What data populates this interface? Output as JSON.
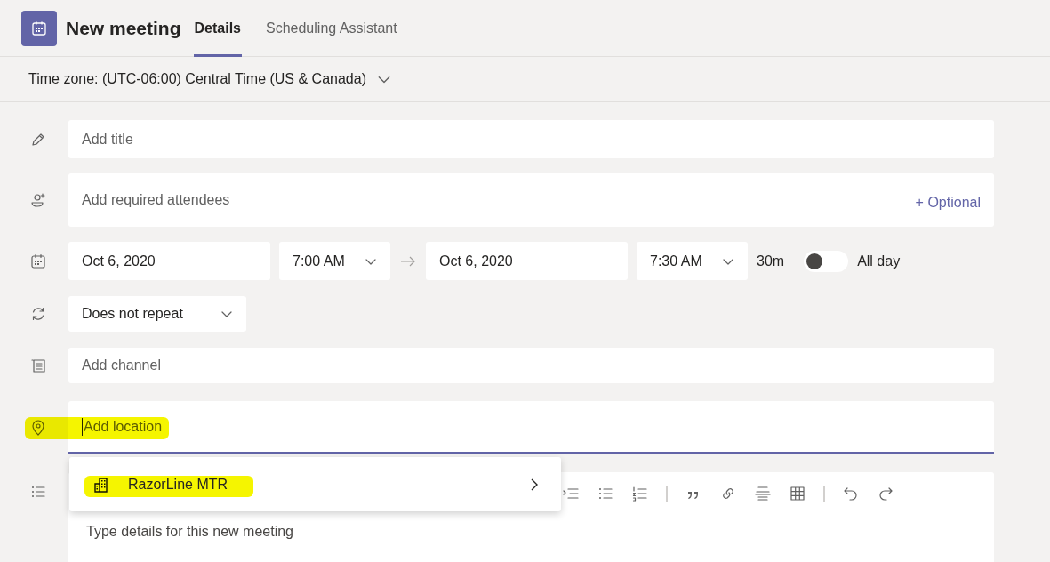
{
  "header": {
    "title": "New meeting",
    "tabs": [
      {
        "label": "Details",
        "selected": true
      },
      {
        "label": "Scheduling Assistant",
        "selected": false
      }
    ]
  },
  "timezone": "Time zone: (UTC-06:00) Central Time (US & Canada)",
  "title_field": {
    "placeholder": "Add title"
  },
  "attendees": {
    "placeholder": "Add required attendees",
    "optional_link": "+ Optional"
  },
  "date_row": {
    "start_date": "Oct 6, 2020",
    "start_time": "7:00 AM",
    "end_date": "Oct 6, 2020",
    "end_time": "7:30 AM",
    "duration": "30m",
    "all_day": {
      "label": "All day",
      "on": false
    }
  },
  "repeat": "Does not repeat",
  "channel": {
    "placeholder": "Add channel"
  },
  "location": {
    "placeholder": "Add location",
    "highlighted": true
  },
  "location_suggestions": [
    {
      "label": "RazorLine MTR",
      "highlighted": true
    }
  ],
  "details": {
    "placeholder": "Type details for this new meeting"
  }
}
